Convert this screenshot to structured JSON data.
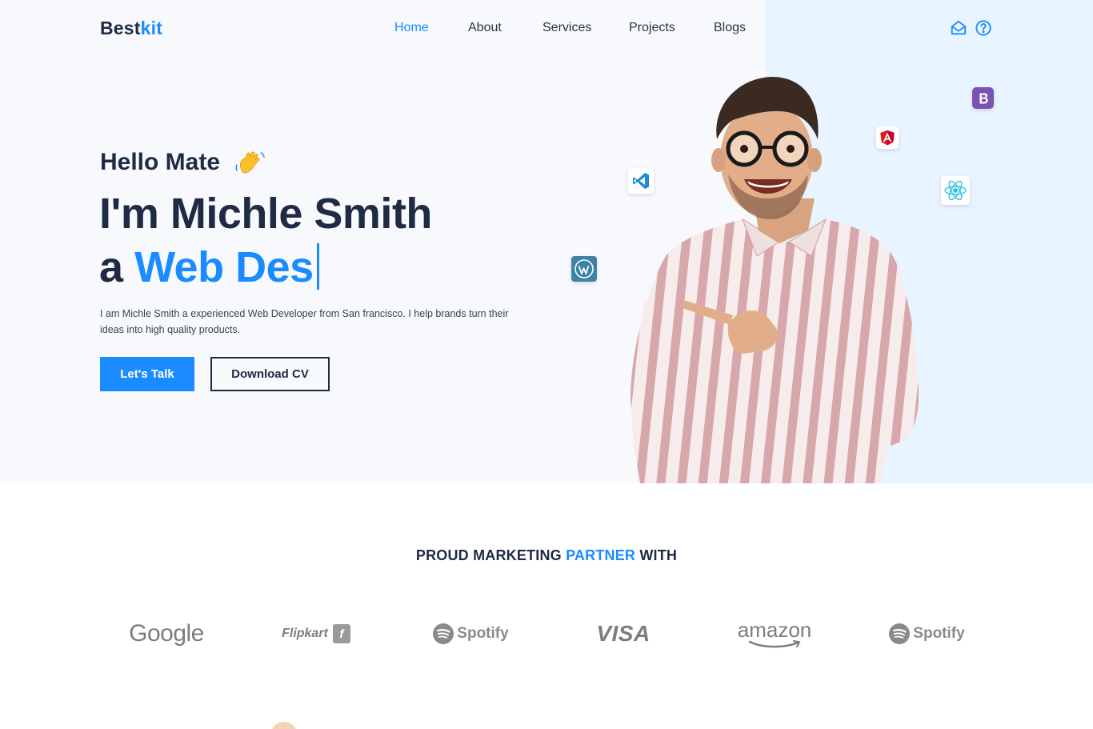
{
  "brand": {
    "part1": "Best",
    "part2": "kit"
  },
  "nav": {
    "items": [
      {
        "label": "Home",
        "active": true
      },
      {
        "label": "About",
        "active": false
      },
      {
        "label": "Services",
        "active": false
      },
      {
        "label": "Projects",
        "active": false
      },
      {
        "label": "Blogs",
        "active": false
      }
    ],
    "icons": [
      "mail-open-icon",
      "help-circle-icon"
    ]
  },
  "hero": {
    "greeting": "Hello Mate",
    "greeting_emoji": "waving-hand-icon",
    "name_line": "I'm Michle Smith",
    "role_prefix": "a",
    "role_highlight": "Web Des",
    "description": "I am Michle Smith a experienced Web Developer from San francisco. I help brands turn their ideas into high quality products.",
    "primary_button": "Let's Talk",
    "secondary_button": "Download CV",
    "tech_icons": [
      "vscode-icon",
      "wordpress-icon",
      "angular-icon",
      "react-icon",
      "bootstrap-icon"
    ]
  },
  "partners": {
    "title_part1": "PROUD MARKETING",
    "title_highlight": "PARTNER",
    "title_part2": "WITH",
    "logos": [
      {
        "name": "google-logo",
        "text": "Google"
      },
      {
        "name": "flipkart-logo",
        "text": "Flipkart"
      },
      {
        "name": "spotify-logo",
        "text": "Spotify"
      },
      {
        "name": "visa-logo",
        "text": "VISA"
      },
      {
        "name": "amazon-logo",
        "text": "amazon"
      },
      {
        "name": "spotify-logo-2",
        "text": "Spotify"
      }
    ]
  },
  "colors": {
    "accent": "#1a8cff",
    "heading": "#1f2a44",
    "hero_bg": "#f7f9fc",
    "hero_right_bg": "#e8f4ff",
    "logo_gray": "#808080"
  }
}
